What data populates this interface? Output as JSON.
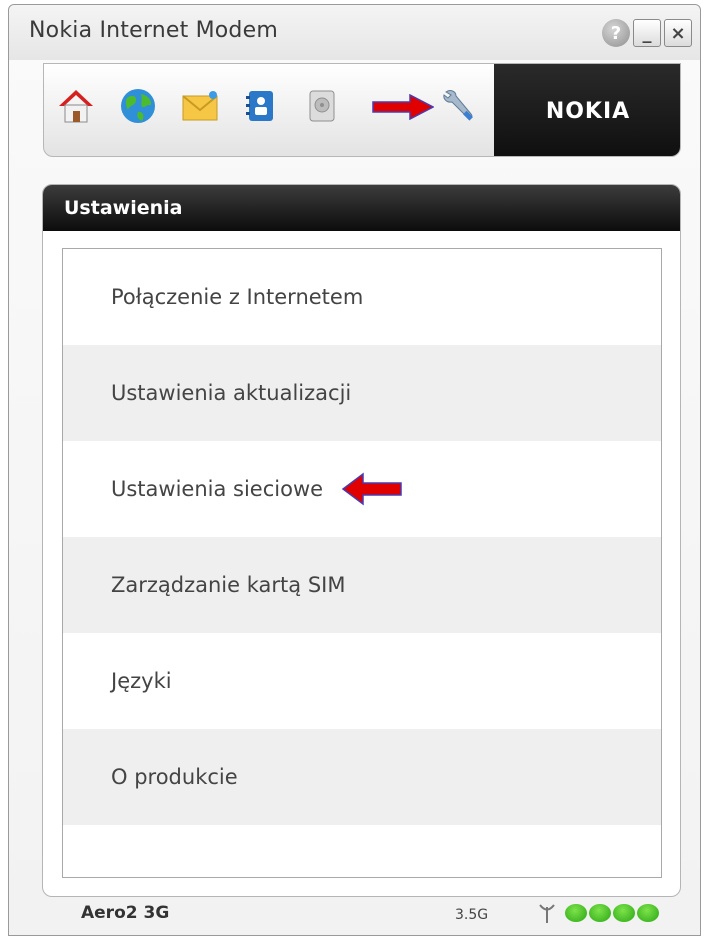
{
  "window": {
    "title": "Nokia Internet Modem"
  },
  "titlebar_buttons": {
    "help": "?",
    "minimize": "_",
    "close": "×"
  },
  "toolbar": {
    "icons": [
      "home-icon",
      "globe-icon",
      "envelope-icon",
      "contacts-icon",
      "storage-icon",
      "wrench-icon"
    ],
    "brand": "NOKIA",
    "selected": "wrench-icon"
  },
  "panel": {
    "title": "Ustawienia",
    "items": [
      {
        "label": "Połączenie z Internetem"
      },
      {
        "label": "Ustawienia aktualizacji"
      },
      {
        "label": "Ustawienia sieciowe"
      },
      {
        "label": "Zarządzanie kartą SIM"
      },
      {
        "label": "Języki"
      },
      {
        "label": "O produkcie"
      }
    ]
  },
  "status": {
    "device": "Aero2 3G",
    "network": "3.5G",
    "signal_bars": 4
  },
  "colors": {
    "annotation_arrow": "#e00000",
    "signal": "#3cc21e"
  }
}
